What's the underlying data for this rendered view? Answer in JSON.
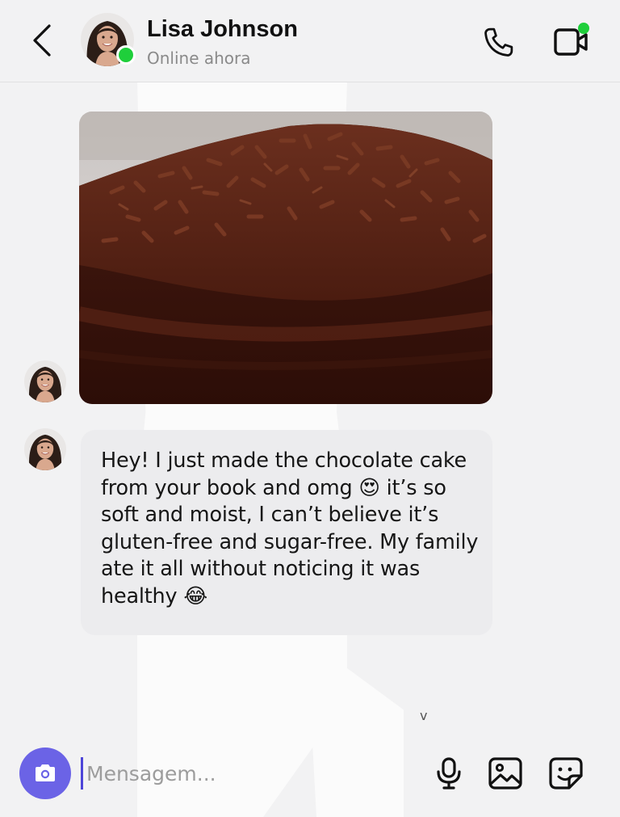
{
  "header": {
    "back_icon": "chevron-left-icon",
    "contact_name": "Lisa Johnson",
    "status": "Online ahora",
    "call_icon": "phone-icon",
    "video_icon": "video-call-icon",
    "online_color": "#1fcf3b"
  },
  "messages": [
    {
      "type": "image",
      "depicts": "chocolate-cake-photo"
    },
    {
      "type": "text",
      "text": "Hey! I just made the chocolate cake from your book and omg 😍 it’s so soft and moist, I can’t believe it’s gluten-free and sugar-free. My family ate it all without noticing it was healthy 😂"
    }
  ],
  "scroll_indicator": "v",
  "composer": {
    "placeholder": "Mensagem...",
    "camera_icon": "camera-icon",
    "mic_icon": "microphone-icon",
    "gallery_icon": "image-icon",
    "sticker_icon": "sticker-icon",
    "accent": "#6b63e6"
  }
}
